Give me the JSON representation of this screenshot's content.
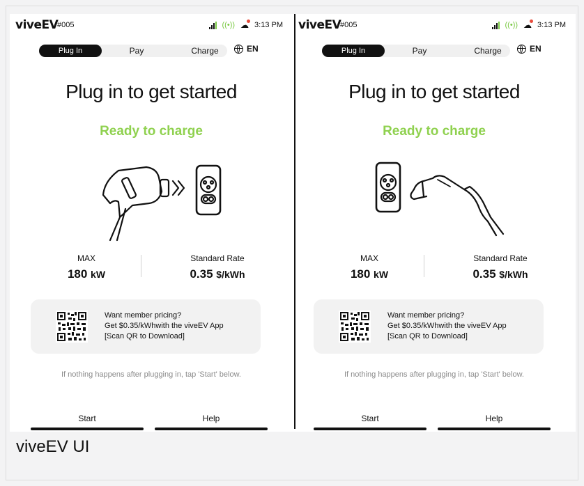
{
  "caption": "viveEV UI",
  "panels": [
    {
      "brand": "viveEV",
      "station": "#005",
      "time": "3:13 PM",
      "tabs": {
        "plugin": "Plug In",
        "pay": "Pay",
        "charge": "Charge"
      },
      "lang": "EN",
      "title": "Plug in to get started",
      "status": "Ready to charge",
      "max_label": "MAX",
      "max_value": "180",
      "max_unit": "kW",
      "rate_label": "Standard Rate",
      "rate_value": "0.35",
      "rate_unit": "$/kWh",
      "promo": {
        "line1": "Want member pricing?",
        "line2": "Get $0.35/kWhwith the viveEV App",
        "line3": "[Scan QR to Download]"
      },
      "hint": "If nothing happens after plugging in, tap 'Start' below.",
      "start": "Start",
      "help": "Help"
    },
    {
      "brand": "viveEV",
      "station": "#005",
      "time": "3:13 PM",
      "tabs": {
        "plugin": "Plug In",
        "pay": "Pay",
        "charge": "Charge"
      },
      "lang": "EN",
      "title": "Plug in to get started",
      "status": "Ready to charge",
      "max_label": "MAX",
      "max_value": "180",
      "max_unit": "kW",
      "rate_label": "Standard Rate",
      "rate_value": "0.35",
      "rate_unit": "$/kWh",
      "promo": {
        "line1": "Want member pricing?",
        "line2": "Get $0.35/kWhwith the viveEV App",
        "line3": "[Scan QR to Download]"
      },
      "hint": "If nothing happens after plugging in, tap 'Start' below.",
      "start": "Start",
      "help": "Help"
    }
  ],
  "colors": {
    "accent_green": "#8fd14f",
    "dark": "#111111"
  }
}
